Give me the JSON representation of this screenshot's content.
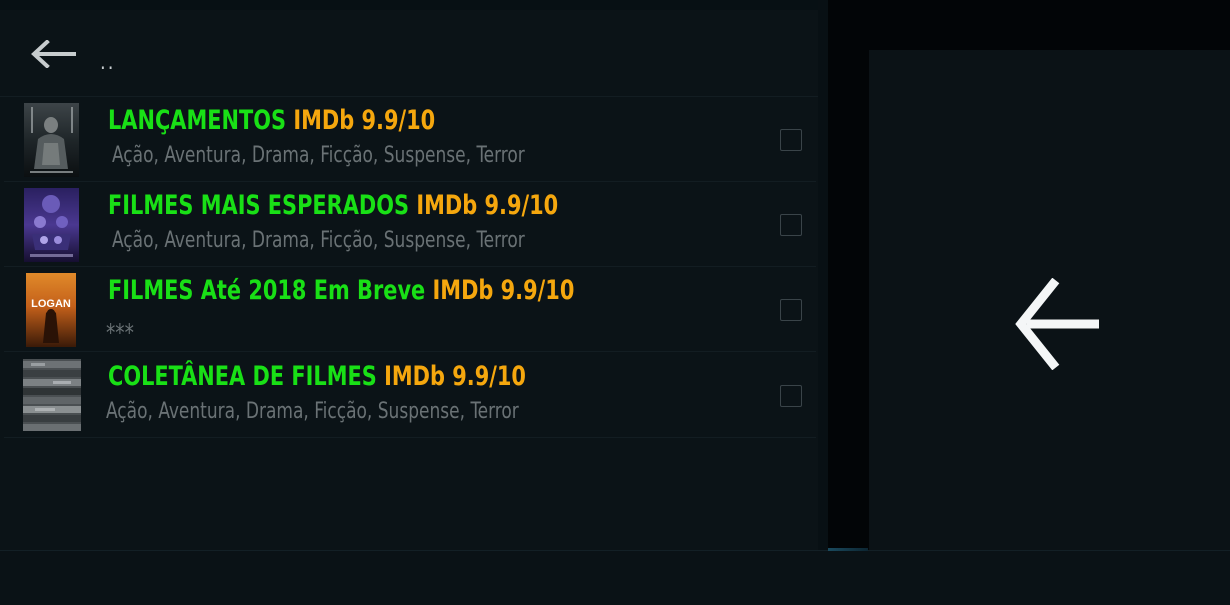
{
  "parent": {
    "label": "..",
    "icon": "back-arrow-icon"
  },
  "items": [
    {
      "title": "LANÇAMENTOS",
      "rating": "IMDb 9.9/10",
      "subtitle": " Ação, Aventura, Drama, Ficção, Suspense, Terror",
      "thumb": "aquaman-poster"
    },
    {
      "title": "FILMES MAIS ESPERADOS",
      "rating": "IMDb 9.9/10",
      "subtitle": " Ação, Aventura, Drama, Ficção, Suspense, Terror",
      "thumb": "avengers-poster"
    },
    {
      "title": "FILMES Até 2018 Em Breve",
      "rating": "IMDb 9.9/10",
      "subtitle": "***",
      "thumb": "logan-poster",
      "thumb_text": "LOGAN"
    },
    {
      "title": "COLETÂNEA DE FILMES",
      "rating": "IMDb 9.9/10",
      "subtitle": "Ação, Aventura, Drama, Ficção, Suspense, Terror",
      "thumb": "dvd-collection-thumbnail"
    }
  ],
  "preview": {
    "icon": "back-arrow-icon"
  },
  "colors": {
    "title_green": "#19e016",
    "rating_orange": "#f5a70e",
    "subtitle_gray": "#6a7275",
    "background": "#0b1317"
  }
}
